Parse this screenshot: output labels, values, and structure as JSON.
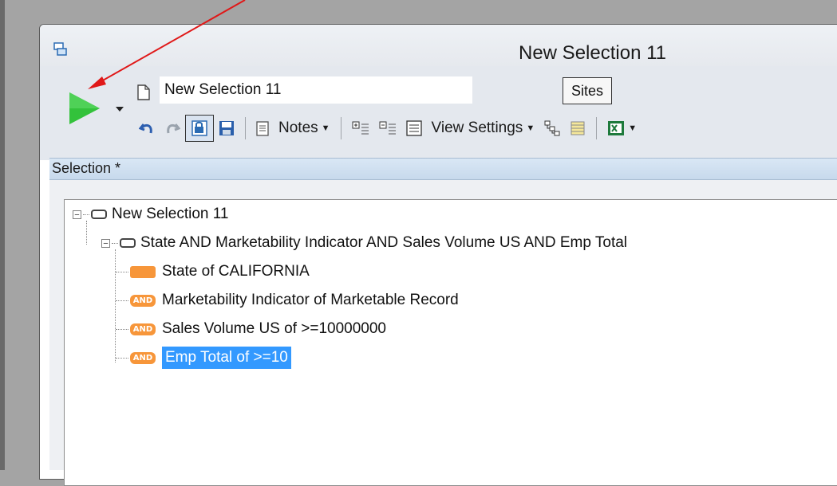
{
  "window": {
    "title": "New Selection 11"
  },
  "toolbar": {
    "name_value": "New Selection 11",
    "sites_label": "Sites",
    "notes_label": "Notes",
    "view_settings_label": "View Settings"
  },
  "selection_bar": {
    "label": "Selection *"
  },
  "tree": {
    "root": "New Selection 11",
    "group": "State AND Marketability Indicator AND Sales Volume US AND Emp Total",
    "items": [
      {
        "label": "State of CALIFORNIA",
        "badge": ""
      },
      {
        "label": "Marketability Indicator of Marketable Record",
        "badge": "AND"
      },
      {
        "label": "Sales Volume US of >=10000000",
        "badge": "AND"
      },
      {
        "label": "Emp Total of >=10",
        "badge": "AND"
      }
    ]
  },
  "colors": {
    "run_green": "#33c23b",
    "condition_orange": "#f7963a",
    "selection_blue": "#3399ff",
    "annotation_arrow": "#e01818"
  },
  "icons": [
    "run-icon",
    "dropdown-icon",
    "document-icon",
    "undo-icon",
    "redo-icon",
    "lock-icon",
    "save-icon",
    "notes-icon",
    "add-condition-icon",
    "remove-condition-icon",
    "view-icon",
    "tree-icon",
    "list-icon",
    "excel-icon",
    "window-icon"
  ]
}
